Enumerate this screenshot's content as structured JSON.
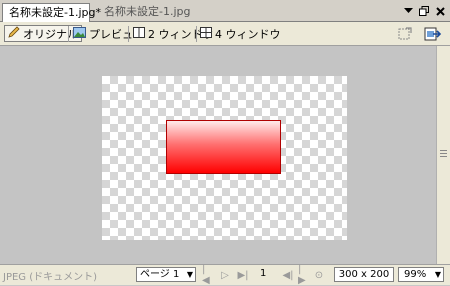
{
  "tabs": [
    {
      "label": "名称未設定-1.jpg*"
    },
    {
      "label": "名称未設定-1.jpg"
    }
  ],
  "window_buttons": [
    "chevron-down-icon",
    "restore-icon",
    "close-icon"
  ],
  "toolbar": {
    "original_label": "オリジナル",
    "preview_label": "プレビュー",
    "two_window_label": "2 ウィンドウ",
    "four_window_label": "4 ウィンドウ"
  },
  "status": {
    "format_label": "JPEG (ドキュメント)",
    "page_select": "ページ 1",
    "page_number": "1",
    "image_size": "300 x 200",
    "zoom": "99%"
  },
  "colors": {
    "shape_fill_top": "#ffeaea",
    "shape_fill_bottom": "#ff0000",
    "canvas_bg": "#c4c4c4"
  }
}
